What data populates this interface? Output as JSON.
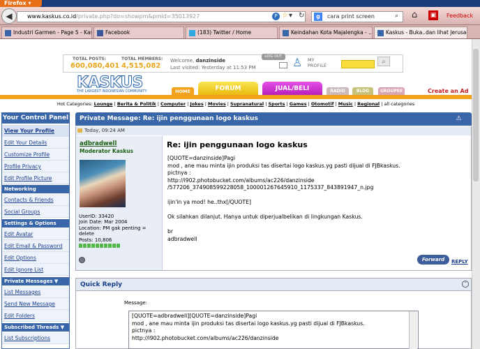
{
  "browser": {
    "app_name": "Firefox",
    "url_domain": "www.kaskus.co.id",
    "url_rest": "/private.php?do=showpm&pmid=35013927",
    "search_text": "cara print screen",
    "feedback_label": "Feedback",
    "tabs": [
      {
        "label": "Industri Garmen - Page 5 - Kas..."
      },
      {
        "label": "Facebook"
      },
      {
        "label": "(183) Twitter / Home"
      },
      {
        "label": "Keindahan Kota Majalengka - ..."
      },
      {
        "label": "Kaskus - Buka..dan lihat Jerusal..."
      }
    ]
  },
  "stats": {
    "posts_label": "TOTAL POSTS:",
    "posts_value": "600,080,401",
    "members_label": "TOTAL MEMBERS:",
    "members_value": "4,515,082",
    "welcome_prefix": "Welcome,",
    "welcome_user": "danzinside",
    "last_visited": "Last visited: Yesterday at 11:53 PM",
    "logout_label": "LOG OUT",
    "profile_label": "MY PROFILE"
  },
  "logo": {
    "text": "KASKUS",
    "tagline": "THE LARGEST INDONESIAN COMMUNITY"
  },
  "nav": {
    "home": "HOME",
    "forum": "FORUM",
    "jualbeli": "JUAL/BELI",
    "radio": "RADIO",
    "blog": "BLOG",
    "groupee": "GROUPEE",
    "create_ad": "Create an Ad"
  },
  "hot_categories": {
    "label": "Hot Categories:",
    "items": [
      "Lounge",
      "Berita & Politik",
      "Computer",
      "Jokes",
      "Movies",
      "Supranatural",
      "Sports",
      "Games",
      "Otomotif",
      "Music",
      "Regional"
    ],
    "all": "all categories"
  },
  "sidebar": {
    "title": "Your Control Panel",
    "items": [
      {
        "label": "View Your Profile",
        "type": "item"
      },
      {
        "label": "Edit Your Details",
        "type": "item"
      },
      {
        "label": "Customize Profile",
        "type": "item"
      },
      {
        "label": "Profile Privacy",
        "type": "item"
      },
      {
        "label": "Edit Profile Picture",
        "type": "item"
      },
      {
        "label": "Networking",
        "type": "section"
      },
      {
        "label": "Contacts & Friends",
        "type": "item"
      },
      {
        "label": "Social Groups",
        "type": "item"
      },
      {
        "label": "Settings & Options",
        "type": "section"
      },
      {
        "label": "Edit Avatar",
        "type": "item"
      },
      {
        "label": "Edit Email & Password",
        "type": "item"
      },
      {
        "label": "Edit Options",
        "type": "item"
      },
      {
        "label": "Edit Ignore List",
        "type": "item"
      },
      {
        "label": "Private Messages ▼",
        "type": "section"
      },
      {
        "label": "List Messages",
        "type": "item"
      },
      {
        "label": "Send New Message",
        "type": "item"
      },
      {
        "label": "Edit Folders",
        "type": "item"
      },
      {
        "label": "Subscribed Threads ▼",
        "type": "section"
      },
      {
        "label": "List Subscriptions",
        "type": "item"
      }
    ]
  },
  "pm": {
    "header": "Private Message: Re: ijin penggunaan logo kaskus",
    "date": "Today, 09:24 AM",
    "username": "adbradwell",
    "usertitle": "Moderator Kaskus",
    "userid": "UserID: 33420",
    "join_date": "Join Date: Mar 2004",
    "location": "Location: PM gak penting = delete",
    "posts": "Posts: 10,806",
    "title": "Re: ijin penggunaan logo kaskus",
    "body": "[QUOTE=danzinside]Pagi\nmod , ane mau minta ijin produksi tas disertai logo kaskus.yg pasti dijual di FJBkaskus.\npictnya :\nhttp://i902.photobucket.com/albums/ac226/danzinside\n/577206_374908599228058_100001267645910_1175337_843891947_n.jpg\n\nijin'in ya mod! he..thx[/QUOTE]\n\nOk silahkan dilanjut. Hanya untuk diperjualbelikan di lingkungan Kaskus.\n\nbr\nadbradwell",
    "forward_label": "Forward",
    "reply_label": "REPLY"
  },
  "quick_reply": {
    "title": "Quick Reply",
    "message_label": "Message:",
    "message_value": "[QUOTE=adbradwell][QUOTE=danzinside]Pagi\nmod , ane mau minta ijin produksi tas disertai logo kaskus.yg pasti dijual di FJBkaskus.\npictnya :\nhttp://i902.photobucket.com/albums/ac226/danzinside"
  },
  "colors": {
    "header_blue": "#3866a8",
    "accent_orange": "#f3a21c",
    "mod_green": "#1a5e12"
  }
}
